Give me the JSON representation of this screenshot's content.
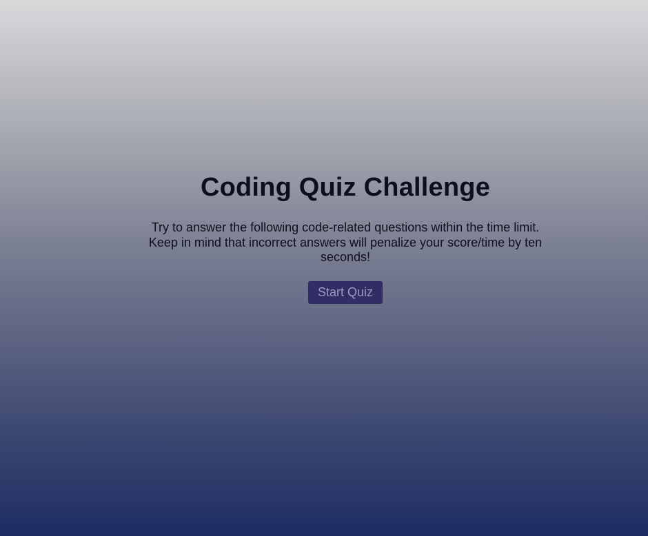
{
  "quiz": {
    "title": "Coding Quiz Challenge",
    "description": "Try to answer the following code-related questions within the time limit. Keep in mind that incorrect answers will penalize your score/time by ten seconds!",
    "start_label": "Start Quiz"
  },
  "colors": {
    "background_top": "#d8d9db",
    "background_bottom": "#1d2c63",
    "button_bg": "#312d66",
    "button_text": "#9a9cbf",
    "text": "#0d0f1c"
  }
}
